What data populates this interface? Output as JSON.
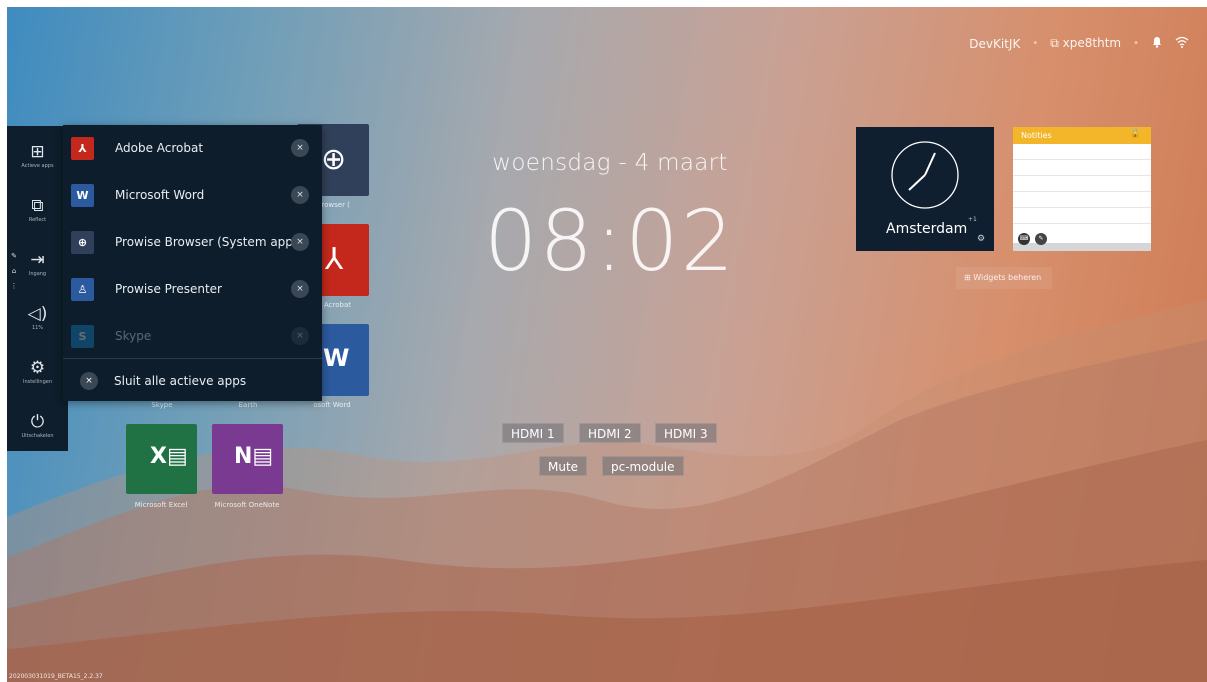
{
  "status": {
    "user": "DevKitJK",
    "device": "xpe8thtm",
    "bell_icon": "bell-icon",
    "wifi_icon": "wifi-icon"
  },
  "date": "woensdag - 4 maart",
  "time": "08:02",
  "sources": {
    "hdmi1": "HDMI 1",
    "hdmi2": "HDMI 2",
    "hdmi3": "HDMI 3",
    "mute": "Mute",
    "pc": "pc-module"
  },
  "clock_widget": {
    "city": "Amsterdam",
    "offset": "+1"
  },
  "notes_widget": {
    "title": "Notities"
  },
  "widgets_button": "Widgets beheren",
  "sidebar": {
    "active_apps": "Actieve apps",
    "reflect": "Reflect",
    "input": "Ingang",
    "volume": "11%",
    "settings": "Instellingen",
    "shutdown": "Uitschakelen"
  },
  "popup": {
    "apps": [
      {
        "name": "Adobe Acrobat"
      },
      {
        "name": "Microsoft Word"
      },
      {
        "name": "Prowise Browser (System app)"
      },
      {
        "name": "Prowise Presenter"
      },
      {
        "name": "Skype"
      }
    ],
    "close_all": "Sluit alle actieve apps"
  },
  "tiles": {
    "browser": "e Browser (",
    "acrobat": "be Acrobat",
    "word": "osoft Word",
    "skype": "Skype",
    "earth": "Earth",
    "excel": "Microsoft Excel",
    "onenote": "Microsoft OneNote"
  },
  "build": "202003031019_BETA15_2.2.37"
}
